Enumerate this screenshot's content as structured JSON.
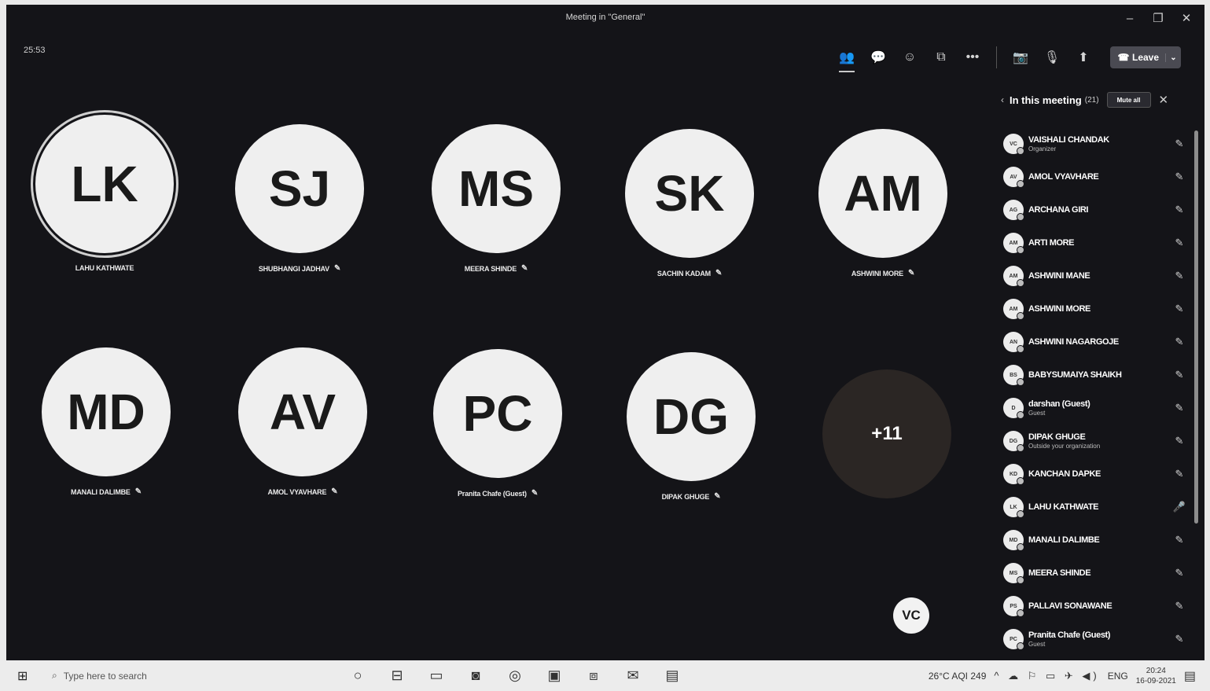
{
  "window": {
    "title": "Meeting in \"General\"",
    "controls": [
      "–",
      "❐",
      "✕"
    ]
  },
  "call": {
    "timer": "25:53"
  },
  "toolbar": {
    "people_icon": "👥",
    "chat_icon": "💬",
    "reactions_icon": "☺",
    "rooms_icon": "⧉",
    "more_icon": "•••",
    "camera_icon": "📷",
    "mic_icon": "🎙",
    "share_icon": "⬆",
    "leave_label": "Leave",
    "leave_icon": "☎",
    "leave_chevron": "⌄"
  },
  "tiles": [
    {
      "initials": "LK",
      "name": "LAHU KATHWATE",
      "mic": ""
    },
    {
      "initials": "SJ",
      "name": "SHUBHANGI JADHAV",
      "mic": "✎"
    },
    {
      "initials": "MS",
      "name": "MEERA SHINDE",
      "mic": "✎"
    },
    {
      "initials": "SK",
      "name": "SACHIN KADAM",
      "mic": "✎"
    },
    {
      "initials": "AM",
      "name": "ASHWINI MORE",
      "mic": "✎"
    },
    {
      "initials": "MD",
      "name": "MANALI DALIMBE",
      "mic": "✎"
    },
    {
      "initials": "AV",
      "name": "AMOL VYAVHARE",
      "mic": "✎"
    },
    {
      "initials": "PC",
      "name": "Pranita Chafe (Guest)",
      "mic": "✎"
    },
    {
      "initials": "DG",
      "name": "DIPAK GHUGE",
      "mic": "✎"
    }
  ],
  "overflow_count": "+11",
  "self_initials": "VC",
  "panel": {
    "back": "‹",
    "title": "In this meeting",
    "count": "(21)",
    "mute_all": "Mute all",
    "close": "✕",
    "participants": [
      {
        "initials": "VC",
        "name": "VAISHALI CHANDAK",
        "sub": "Organizer",
        "mic": "✎"
      },
      {
        "initials": "AV",
        "name": "AMOL VYAVHARE",
        "sub": "",
        "mic": "✎"
      },
      {
        "initials": "AG",
        "name": "ARCHANA GIRI",
        "sub": "",
        "mic": "✎"
      },
      {
        "initials": "AM",
        "name": "ARTI MORE",
        "sub": "",
        "mic": "✎"
      },
      {
        "initials": "AM",
        "name": "ASHWINI MANE",
        "sub": "",
        "mic": "✎"
      },
      {
        "initials": "AM",
        "name": "ASHWINI MORE",
        "sub": "",
        "mic": "✎"
      },
      {
        "initials": "AN",
        "name": "ASHWINI NAGARGOJE",
        "sub": "",
        "mic": "✎"
      },
      {
        "initials": "BS",
        "name": "BABYSUMAIYA SHAIKH",
        "sub": "",
        "mic": "✎"
      },
      {
        "initials": "D",
        "name": "darshan (Guest)",
        "sub": "Guest",
        "mic": "✎"
      },
      {
        "initials": "DG",
        "name": "DIPAK GHUGE",
        "sub": "Outside your organization",
        "mic": "✎"
      },
      {
        "initials": "KD",
        "name": "KANCHAN DAPKE",
        "sub": "",
        "mic": "✎"
      },
      {
        "initials": "LK",
        "name": "LAHU KATHWATE",
        "sub": "",
        "mic": "🎤"
      },
      {
        "initials": "MD",
        "name": "MANALI DALIMBE",
        "sub": "",
        "mic": "✎"
      },
      {
        "initials": "MS",
        "name": "MEERA SHINDE",
        "sub": "",
        "mic": "✎"
      },
      {
        "initials": "PS",
        "name": "PALLAVI SONAWANE",
        "sub": "",
        "mic": "✎"
      },
      {
        "initials": "PC",
        "name": "Pranita Chafe (Guest)",
        "sub": "Guest",
        "mic": "✎"
      }
    ]
  },
  "taskbar": {
    "start_icon": "⊞",
    "search_icon": "⌕",
    "search_placeholder": "Type here to search",
    "apps": [
      "○",
      "⊟",
      "▭",
      "◙",
      "◎",
      "▣",
      "⧈",
      "✉",
      "▤"
    ],
    "weather": "26°C  AQI 249",
    "tray": "^ ☁ ⚐ ▭ ✈ ◀)",
    "lang": "ENG",
    "time": "20:24",
    "date": "16-09-2021",
    "notif_icon": "▤"
  }
}
